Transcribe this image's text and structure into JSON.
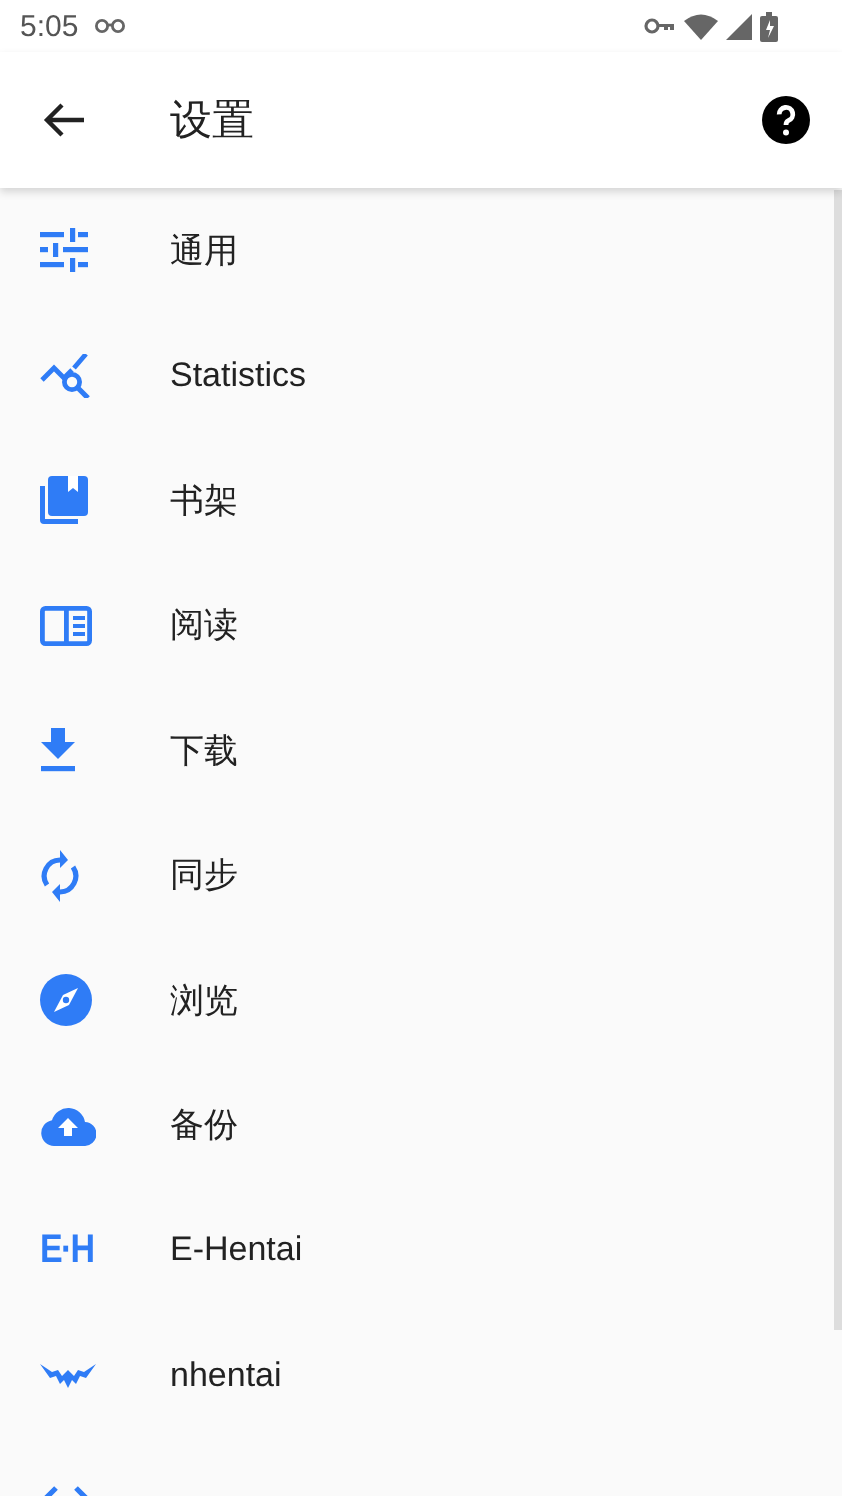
{
  "status_bar": {
    "time": "5:05"
  },
  "app_bar": {
    "title": "设置"
  },
  "items": [
    {
      "label": "通用",
      "kind": "tune"
    },
    {
      "label": "Statistics",
      "kind": "stats"
    },
    {
      "label": "书架",
      "kind": "library"
    },
    {
      "label": "阅读",
      "kind": "reader"
    },
    {
      "label": "下载",
      "kind": "download"
    },
    {
      "label": "同步",
      "kind": "sync"
    },
    {
      "label": "浏览",
      "kind": "compass"
    },
    {
      "label": "备份",
      "kind": "cloud"
    },
    {
      "label": "E-Hentai",
      "kind": "logo",
      "logo": "E·H"
    },
    {
      "label": "nhentai",
      "kind": "wings"
    },
    {
      "kind": "code"
    }
  ]
}
